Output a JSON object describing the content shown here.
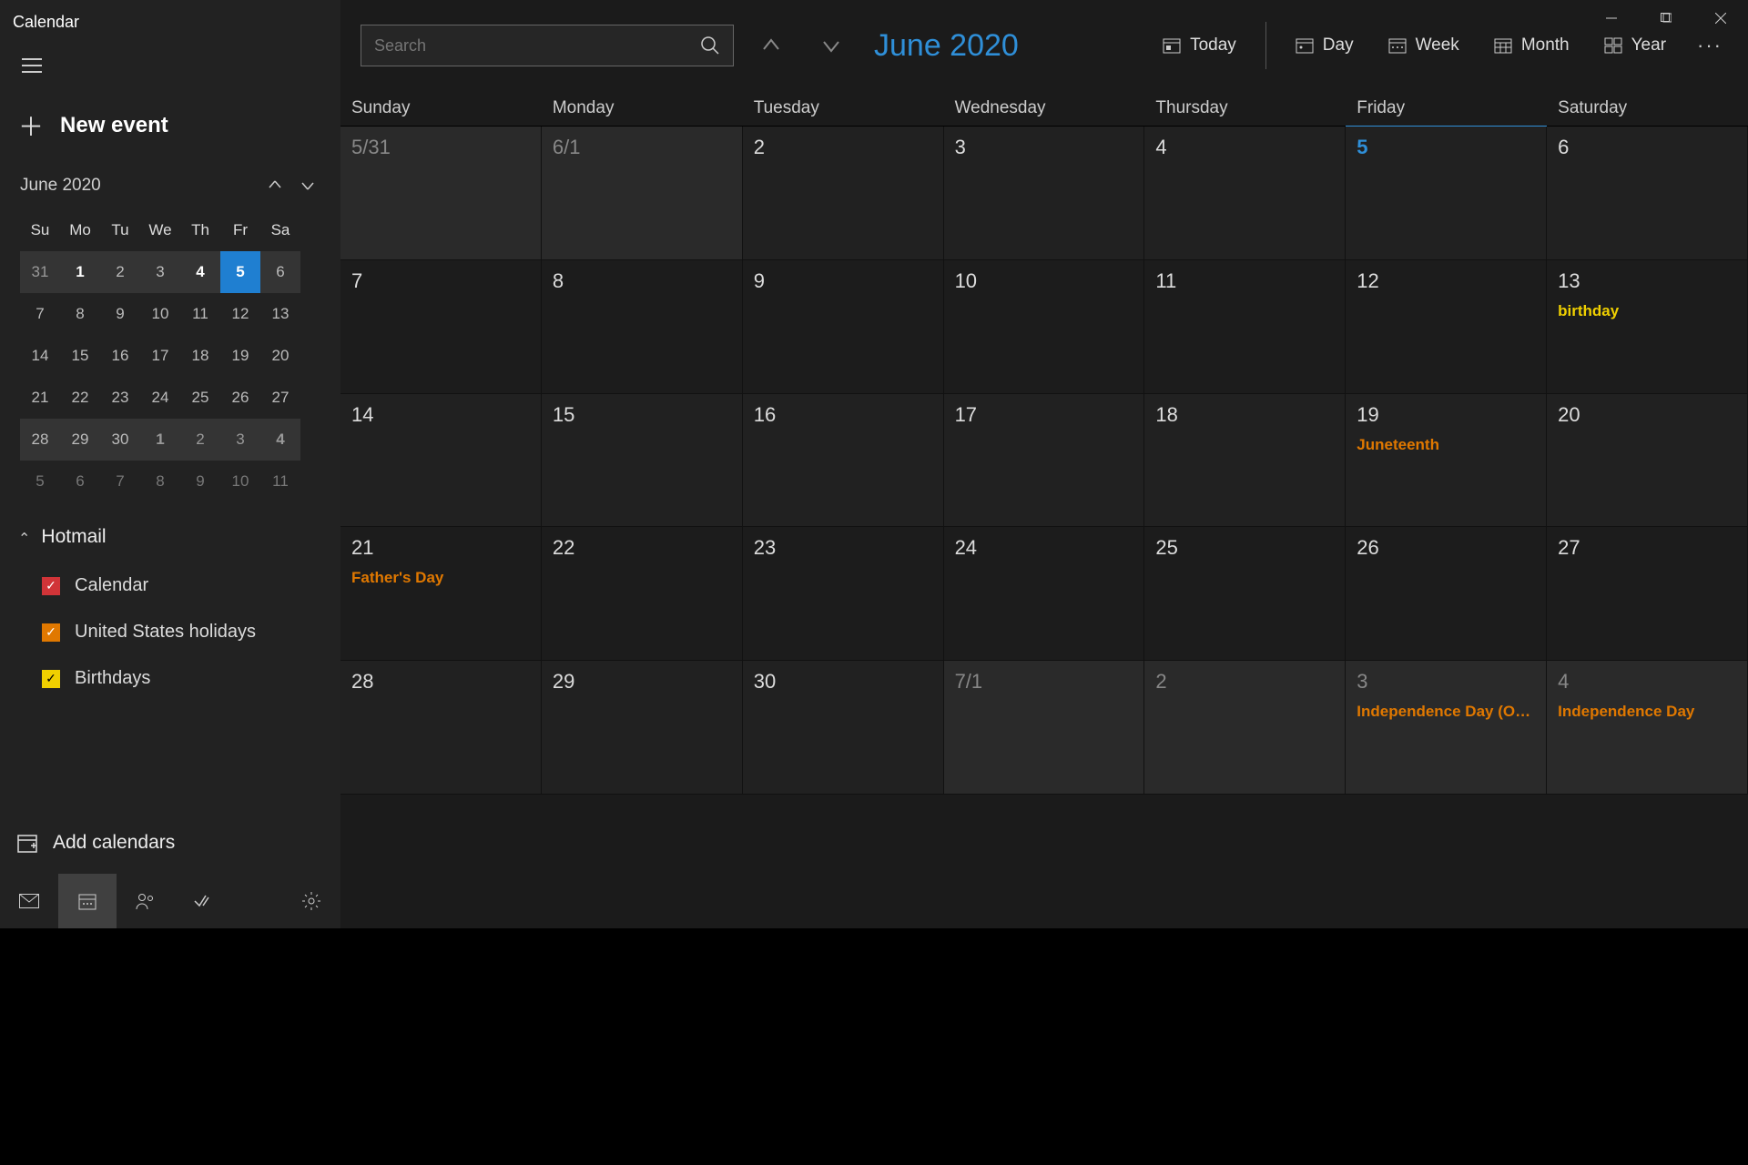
{
  "app_title": "Calendar",
  "new_event_label": "New event",
  "mini_calendar": {
    "title": "June 2020",
    "dow": [
      "Su",
      "Mo",
      "Tu",
      "We",
      "Th",
      "Fr",
      "Sa"
    ],
    "rows": [
      [
        {
          "n": "31",
          "dim": true,
          "bg": true
        },
        {
          "n": "1",
          "bg": true,
          "bold": true
        },
        {
          "n": "2",
          "bg": true
        },
        {
          "n": "3",
          "bg": true
        },
        {
          "n": "4",
          "bg": true,
          "bold": true
        },
        {
          "n": "5",
          "today": true
        },
        {
          "n": "6",
          "bg": true
        }
      ],
      [
        {
          "n": "7"
        },
        {
          "n": "8"
        },
        {
          "n": "9"
        },
        {
          "n": "10"
        },
        {
          "n": "11"
        },
        {
          "n": "12"
        },
        {
          "n": "13"
        }
      ],
      [
        {
          "n": "14"
        },
        {
          "n": "15"
        },
        {
          "n": "16"
        },
        {
          "n": "17"
        },
        {
          "n": "18"
        },
        {
          "n": "19"
        },
        {
          "n": "20"
        }
      ],
      [
        {
          "n": "21"
        },
        {
          "n": "22"
        },
        {
          "n": "23"
        },
        {
          "n": "24"
        },
        {
          "n": "25"
        },
        {
          "n": "26"
        },
        {
          "n": "27"
        }
      ],
      [
        {
          "n": "28",
          "bg": true
        },
        {
          "n": "29",
          "bg": true
        },
        {
          "n": "30",
          "bg": true
        },
        {
          "n": "1",
          "dim": true,
          "bg": true,
          "bold": true
        },
        {
          "n": "2",
          "dim": true,
          "bg": true
        },
        {
          "n": "3",
          "dim": true,
          "bg": true
        },
        {
          "n": "4",
          "dim": true,
          "bg": true,
          "bold": true
        }
      ],
      [
        {
          "n": "5",
          "dim": true
        },
        {
          "n": "6",
          "dim": true
        },
        {
          "n": "7",
          "dim": true
        },
        {
          "n": "8",
          "dim": true
        },
        {
          "n": "9",
          "dim": true
        },
        {
          "n": "10",
          "dim": true
        },
        {
          "n": "11",
          "dim": true
        }
      ]
    ]
  },
  "account_name": "Hotmail",
  "calendars": [
    {
      "label": "Calendar",
      "color": "red"
    },
    {
      "label": "United States holidays",
      "color": "orange"
    },
    {
      "label": "Birthdays",
      "color": "yellow"
    }
  ],
  "add_calendars_label": "Add calendars",
  "search_placeholder": "Search",
  "main_title": "June 2020",
  "view_buttons": {
    "today": "Today",
    "day": "Day",
    "week": "Week",
    "month": "Month",
    "year": "Year"
  },
  "dow_headers": [
    "Sunday",
    "Monday",
    "Tuesday",
    "Wednesday",
    "Thursday",
    "Friday",
    "Saturday"
  ],
  "today_dow_index": 5,
  "month_grid": [
    [
      {
        "label": "5/31",
        "other": true
      },
      {
        "label": "6/1",
        "other": true
      },
      {
        "label": "2"
      },
      {
        "label": "3"
      },
      {
        "label": "4"
      },
      {
        "label": "5",
        "today": true
      },
      {
        "label": "6"
      }
    ],
    [
      {
        "label": "7"
      },
      {
        "label": "8"
      },
      {
        "label": "9"
      },
      {
        "label": "10"
      },
      {
        "label": "11"
      },
      {
        "label": "12"
      },
      {
        "label": "13",
        "events": [
          {
            "text": "birthday",
            "type": "birthday"
          }
        ]
      }
    ],
    [
      {
        "label": "14"
      },
      {
        "label": "15"
      },
      {
        "label": "16"
      },
      {
        "label": "17"
      },
      {
        "label": "18"
      },
      {
        "label": "19",
        "events": [
          {
            "text": "Juneteenth",
            "type": "holiday"
          }
        ]
      },
      {
        "label": "20"
      }
    ],
    [
      {
        "label": "21",
        "events": [
          {
            "text": "Father's Day",
            "type": "holiday"
          }
        ]
      },
      {
        "label": "22"
      },
      {
        "label": "23"
      },
      {
        "label": "24"
      },
      {
        "label": "25"
      },
      {
        "label": "26"
      },
      {
        "label": "27"
      }
    ],
    [
      {
        "label": "28"
      },
      {
        "label": "29"
      },
      {
        "label": "30"
      },
      {
        "label": "7/1",
        "other": true
      },
      {
        "label": "2",
        "other": true
      },
      {
        "label": "3",
        "other": true,
        "events": [
          {
            "text": "Independence Day (Observed)",
            "type": "holiday"
          }
        ]
      },
      {
        "label": "4",
        "other": true,
        "events": [
          {
            "text": "Independence Day",
            "type": "holiday"
          }
        ]
      }
    ],
    []
  ]
}
